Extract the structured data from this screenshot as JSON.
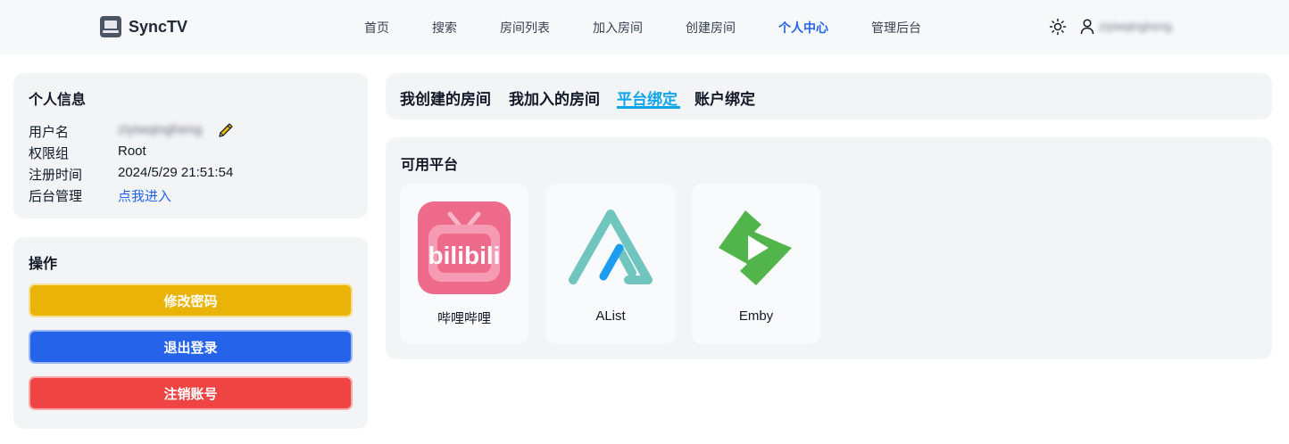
{
  "app": {
    "name": "SyncTV"
  },
  "nav": {
    "items": [
      "首页",
      "搜索",
      "房间列表",
      "加入房间",
      "创建房间",
      "个人中心",
      "管理后台"
    ],
    "active": "个人中心",
    "user_name": "ziyiwqingheng"
  },
  "icons": {
    "brand": "monitor-icon",
    "theme": "sun-icon",
    "user": "user-icon",
    "edit": "pencil-icon"
  },
  "info": {
    "title": "个人信息",
    "username_label": "用户名",
    "username_value": "ziyiwqingheng",
    "group_label": "权限组",
    "group_value": "Root",
    "registered_label": "注册时间",
    "registered_value": "2024/5/29 21:51:54",
    "admin_label": "后台管理",
    "admin_link": "点我进入"
  },
  "ops": {
    "title": "操作",
    "change_password": "修改密码",
    "logout": "退出登录",
    "delete_account": "注销账号"
  },
  "tabs": {
    "items": [
      "我创建的房间",
      "我加入的房间",
      "平台绑定",
      "账户绑定"
    ],
    "active": "平台绑定"
  },
  "platforms": {
    "title": "可用平台",
    "items": [
      {
        "name": "哔哩哔哩",
        "logo": "bilibili-logo",
        "logo_text": "bilibili"
      },
      {
        "name": "AList",
        "logo": "alist-logo"
      },
      {
        "name": "Emby",
        "logo": "emby-logo"
      }
    ]
  },
  "colors": {
    "accent": "#2563eb",
    "tab_active": "#0ea5e9",
    "yellow": "#eab308",
    "red": "#ef4444",
    "bilibili": "#ee6a8b",
    "alist": "#70c6be",
    "emby": "#52b54b"
  }
}
